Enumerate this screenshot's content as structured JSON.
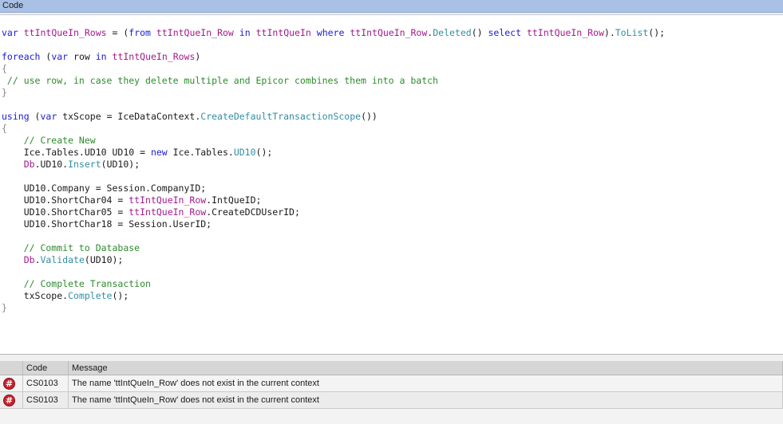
{
  "panel": {
    "title": "Code"
  },
  "code_lines": [
    [
      {
        "t": "var",
        "c": "kw"
      },
      {
        "t": " ",
        "c": "pl"
      },
      {
        "t": "ttIntQueIn_Rows",
        "c": "id"
      },
      {
        "t": " = (",
        "c": "pl"
      },
      {
        "t": "from",
        "c": "kw"
      },
      {
        "t": " ",
        "c": "pl"
      },
      {
        "t": "ttIntQueIn_Row",
        "c": "id"
      },
      {
        "t": " ",
        "c": "pl"
      },
      {
        "t": "in",
        "c": "kw"
      },
      {
        "t": " ",
        "c": "pl"
      },
      {
        "t": "ttIntQueIn",
        "c": "id"
      },
      {
        "t": " ",
        "c": "pl"
      },
      {
        "t": "where",
        "c": "kw"
      },
      {
        "t": " ",
        "c": "pl"
      },
      {
        "t": "ttIntQueIn_Row",
        "c": "id"
      },
      {
        "t": ".",
        "c": "pl"
      },
      {
        "t": "Deleted",
        "c": "fn"
      },
      {
        "t": "() ",
        "c": "pl"
      },
      {
        "t": "select",
        "c": "kw"
      },
      {
        "t": " ",
        "c": "pl"
      },
      {
        "t": "ttIntQueIn_Row",
        "c": "id"
      },
      {
        "t": ").",
        "c": "pl"
      },
      {
        "t": "ToList",
        "c": "fn"
      },
      {
        "t": "();",
        "c": "pl"
      }
    ],
    [],
    [
      {
        "t": "foreach",
        "c": "kw"
      },
      {
        "t": " (",
        "c": "pl"
      },
      {
        "t": "var",
        "c": "kw"
      },
      {
        "t": " row ",
        "c": "pl"
      },
      {
        "t": "in",
        "c": "kw"
      },
      {
        "t": " ",
        "c": "pl"
      },
      {
        "t": "ttIntQueIn_Rows",
        "c": "id"
      },
      {
        "t": ")",
        "c": "pl"
      }
    ],
    [
      {
        "t": "{",
        "c": "br"
      }
    ],
    [
      {
        "t": " // use row, in case they delete multiple and Epicor combines them into a batch",
        "c": "cm"
      }
    ],
    [
      {
        "t": "}",
        "c": "br"
      }
    ],
    [],
    [
      {
        "t": "using",
        "c": "kw"
      },
      {
        "t": " (",
        "c": "pl"
      },
      {
        "t": "var",
        "c": "kw"
      },
      {
        "t": " txScope = IceDataContext.",
        "c": "pl"
      },
      {
        "t": "CreateDefaultTransactionScope",
        "c": "fn"
      },
      {
        "t": "())",
        "c": "pl"
      }
    ],
    [
      {
        "t": "{",
        "c": "br"
      }
    ],
    [
      {
        "t": "    // Create New",
        "c": "cm"
      }
    ],
    [
      {
        "t": "    Ice.Tables.UD10 UD10 = ",
        "c": "pl"
      },
      {
        "t": "new",
        "c": "kw"
      },
      {
        "t": " Ice.Tables.",
        "c": "pl"
      },
      {
        "t": "UD10",
        "c": "fn"
      },
      {
        "t": "();",
        "c": "pl"
      }
    ],
    [
      {
        "t": "    ",
        "c": "pl"
      },
      {
        "t": "Db",
        "c": "id"
      },
      {
        "t": ".UD10.",
        "c": "pl"
      },
      {
        "t": "Insert",
        "c": "fn"
      },
      {
        "t": "(UD10);",
        "c": "pl"
      }
    ],
    [],
    [
      {
        "t": "    UD10.Company = Session.CompanyID;",
        "c": "pl"
      }
    ],
    [
      {
        "t": "    UD10.ShortChar04 = ",
        "c": "pl"
      },
      {
        "t": "ttIntQueIn_Row",
        "c": "id"
      },
      {
        "t": ".IntQueID;",
        "c": "pl"
      }
    ],
    [
      {
        "t": "    UD10.ShortChar05 = ",
        "c": "pl"
      },
      {
        "t": "ttIntQueIn_Row",
        "c": "id"
      },
      {
        "t": ".CreateDCDUserID;",
        "c": "pl"
      }
    ],
    [
      {
        "t": "    UD10.ShortChar18 = Session.UserID;",
        "c": "pl"
      }
    ],
    [],
    [
      {
        "t": "    // Commit to Database",
        "c": "cm"
      }
    ],
    [
      {
        "t": "    ",
        "c": "pl"
      },
      {
        "t": "Db",
        "c": "id"
      },
      {
        "t": ".",
        "c": "pl"
      },
      {
        "t": "Validate",
        "c": "fn"
      },
      {
        "t": "(UD10);",
        "c": "pl"
      }
    ],
    [],
    [
      {
        "t": "    // Complete Transaction",
        "c": "cm"
      }
    ],
    [
      {
        "t": "    txScope.",
        "c": "pl"
      },
      {
        "t": "Complete",
        "c": "fn"
      },
      {
        "t": "();",
        "c": "pl"
      }
    ],
    [
      {
        "t": "}",
        "c": "br"
      }
    ]
  ],
  "error_list": {
    "columns": {
      "icon": "",
      "code": "Code",
      "message": "Message"
    },
    "icon_name": "error-hash-icon",
    "icon_glyph": "#",
    "rows": [
      {
        "code": "CS0103",
        "message": "The name 'ttIntQueIn_Row' does not exist in the current context"
      },
      {
        "code": "CS0103",
        "message": "The name 'ttIntQueIn_Row' does not exist in the current context"
      }
    ]
  }
}
